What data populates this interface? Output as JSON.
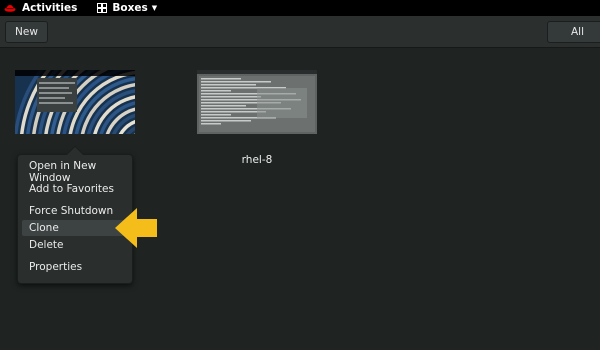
{
  "topbar": {
    "activities_label": "Activities",
    "app_menu_label": "Boxes",
    "logo_icon": "redhat-logo-icon",
    "app_icon": "boxes-icon",
    "caret_icon": "chevron-down-icon"
  },
  "headerbar": {
    "new_button_label": "New",
    "all_button_label": "All"
  },
  "boxes": [
    {
      "label": "",
      "thumbnail": "wallpaper-screenshot"
    },
    {
      "label": "rhel-8",
      "thumbnail": "terminal-screenshot"
    }
  ],
  "context_menu": {
    "items": [
      {
        "label": "Open in New Window"
      },
      {
        "label": "Add to Favorites"
      },
      {
        "label": "Force Shutdown"
      },
      {
        "label": "Clone",
        "highlighted": true
      },
      {
        "label": "Delete"
      },
      {
        "label": "Properties"
      }
    ]
  },
  "annotation": {
    "arrow_icon": "left-arrow-icon",
    "arrow_color": "#f5bd1a"
  },
  "colors": {
    "background": "#1f2423",
    "topbar": "#000000",
    "headerbar": "#2b302f",
    "popover": "#2a2f2e",
    "accent_red": "#ee0000"
  }
}
